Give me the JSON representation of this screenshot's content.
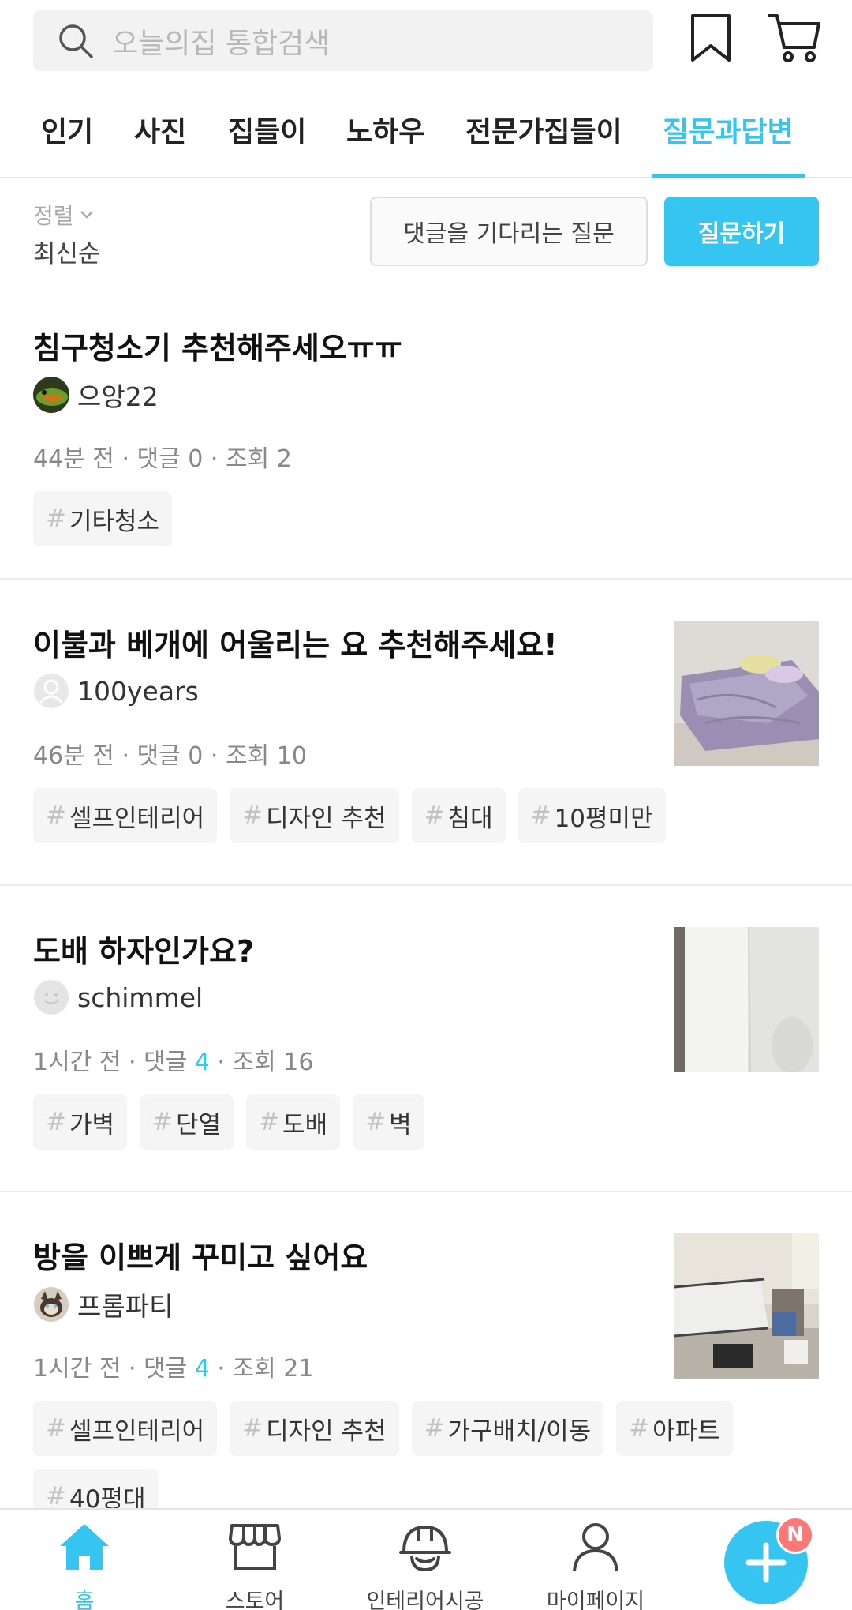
{
  "search": {
    "placeholder": "오늘의집 통합검색"
  },
  "tabs": [
    {
      "label": "인기",
      "active": false
    },
    {
      "label": "사진",
      "active": false
    },
    {
      "label": "집들이",
      "active": false
    },
    {
      "label": "노하우",
      "active": false
    },
    {
      "label": "전문가집들이",
      "active": false
    },
    {
      "label": "질문과답변",
      "active": true
    }
  ],
  "sort": {
    "label": "정렬",
    "value": "최신순"
  },
  "actions": {
    "waiting": "댓글을 기다리는 질문",
    "ask": "질문하기"
  },
  "posts": [
    {
      "title": "침구청소기 추천해주세오ㅠㅠ",
      "author": "으앙22",
      "time": "44분 전",
      "comments_label": "댓글",
      "comments": "0",
      "views_label": "조회",
      "views": "2",
      "tags": [
        "기타청소"
      ]
    },
    {
      "title": "이불과 베개에 어울리는 요 추천해주세요!",
      "author": "100years",
      "time": "46분 전",
      "comments_label": "댓글",
      "comments": "0",
      "views_label": "조회",
      "views": "10",
      "tags": [
        "셀프인테리어",
        "디자인 추천",
        "침대",
        "10평미만"
      ]
    },
    {
      "title": "도배 하자인가요?",
      "author": "schimmel",
      "time": "1시간 전",
      "comments_label": "댓글",
      "comments": "4",
      "views_label": "조회",
      "views": "16",
      "tags": [
        "가벽",
        "단열",
        "도배",
        "벽"
      ]
    },
    {
      "title": "방을 이쁘게 꾸미고 싶어요",
      "author": "프롬파티",
      "time": "1시간 전",
      "comments_label": "댓글",
      "comments": "4",
      "views_label": "조회",
      "views": "21",
      "tags": [
        "셀프인테리어",
        "디자인 추천",
        "가구배치/이동",
        "아파트",
        "40평대"
      ]
    }
  ],
  "nav": {
    "home": "홈",
    "store": "스토어",
    "interior": "인테리어시공",
    "mypage": "마이페이지",
    "badge": "N"
  },
  "colors": {
    "accent": "#35c5f0",
    "badge": "#f77777"
  }
}
